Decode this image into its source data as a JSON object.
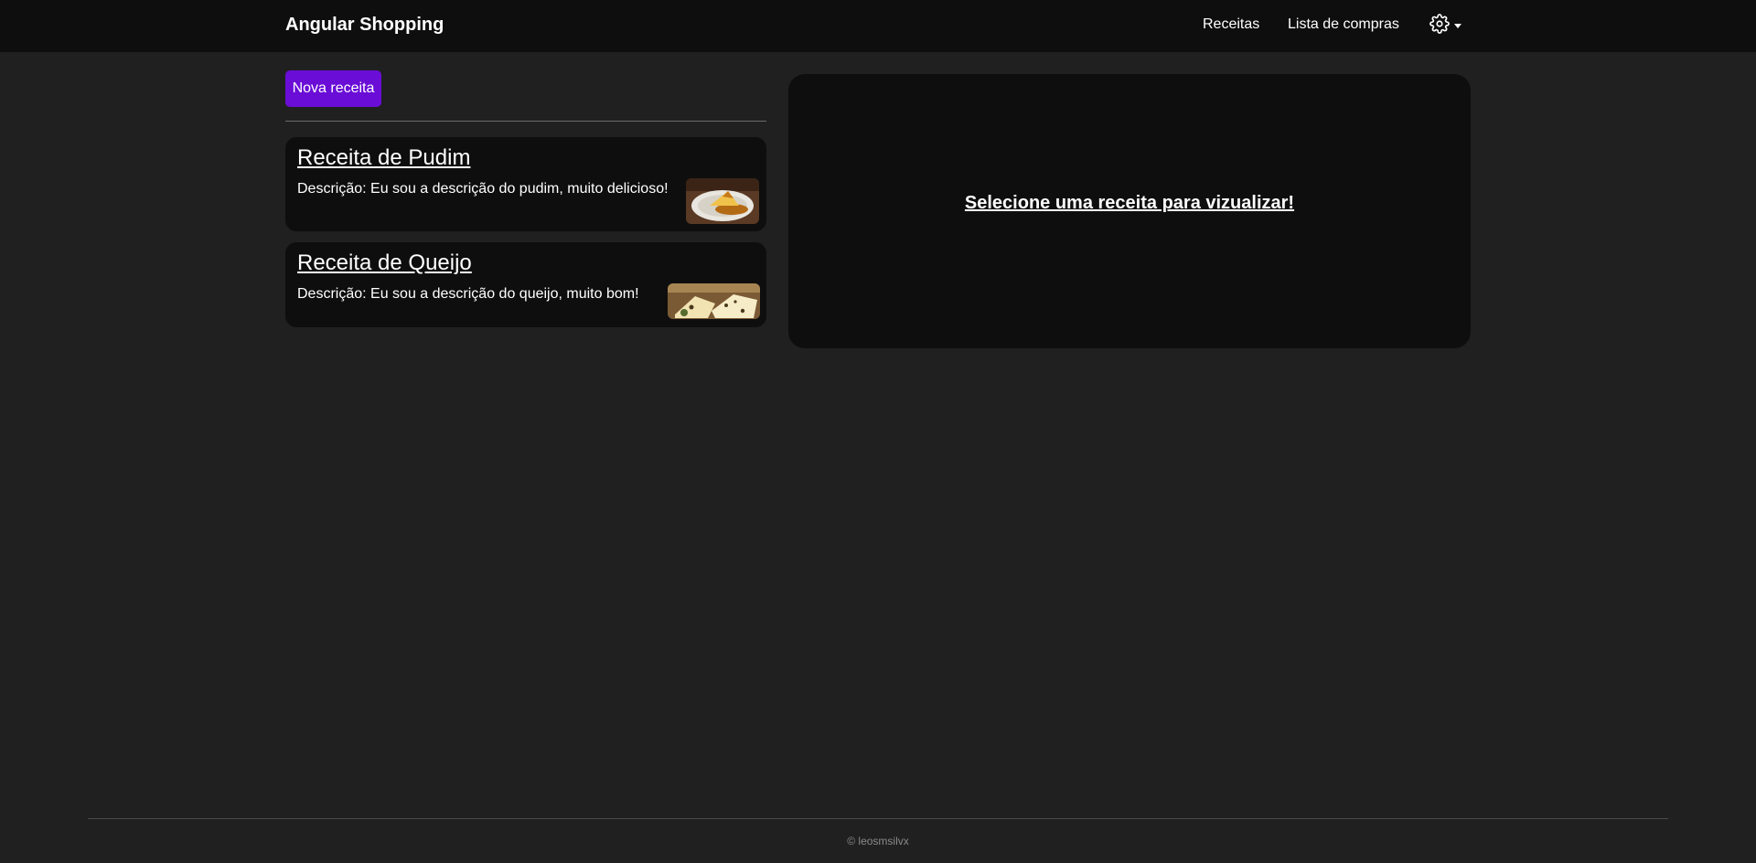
{
  "navbar": {
    "brand": "Angular Shopping",
    "links": [
      {
        "label": "Receitas"
      },
      {
        "label": "Lista de compras"
      }
    ],
    "settings_icon": "gear-icon"
  },
  "recipes_panel": {
    "new_button_label": "Nova receita",
    "items": [
      {
        "title": "Receita de Pudim",
        "description": "Descrição: Eu sou a descrição do pudim, muito delicioso!",
        "image": "pudim-photo"
      },
      {
        "title": "Receita de Queijo",
        "description": "Descrição: Eu sou a descrição do queijo, muito bom!",
        "image": "queijo-photo"
      }
    ]
  },
  "detail": {
    "message": "Selecione uma receita para vizualizar!"
  },
  "footer": {
    "text": "© leosmsilvx"
  },
  "colors": {
    "background": "#202020",
    "navbar": "#0e0e0e",
    "card": "#0e0e0e",
    "accent": "#6a0dd6"
  }
}
